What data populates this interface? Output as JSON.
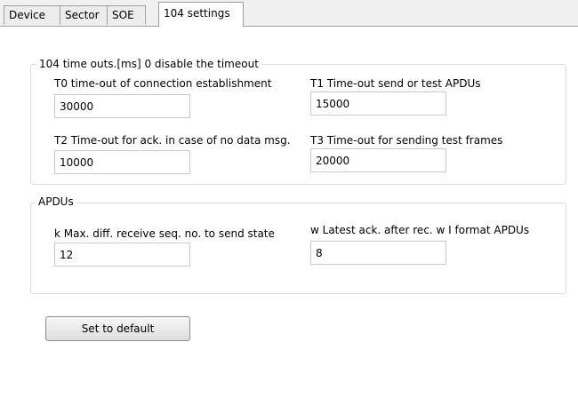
{
  "tabs": [
    {
      "label": "Device"
    },
    {
      "label": "Sector"
    },
    {
      "label": "SOE"
    },
    {
      "label": "104 settings"
    }
  ],
  "timeouts_group": {
    "title": "104 time outs.[ms] 0 disable the timeout",
    "t0": {
      "label": "T0 time-out of connection establishment",
      "value": "30000"
    },
    "t1": {
      "label": "T1 Time-out send or test APDUs",
      "value": "15000"
    },
    "t2": {
      "label": "T2 Time-out for ack. in case of no data msg.",
      "value": "10000"
    },
    "t3": {
      "label": "T3 Time-out for sending test frames",
      "value": "20000"
    }
  },
  "apdus_group": {
    "title": "APDUs",
    "k": {
      "label": "k Max. diff. receive seq. no. to send state",
      "value": "12"
    },
    "w": {
      "label": "w Latest ack. after rec. w I format APDUs",
      "value": "8"
    }
  },
  "default_button": {
    "label": "Set to default"
  }
}
